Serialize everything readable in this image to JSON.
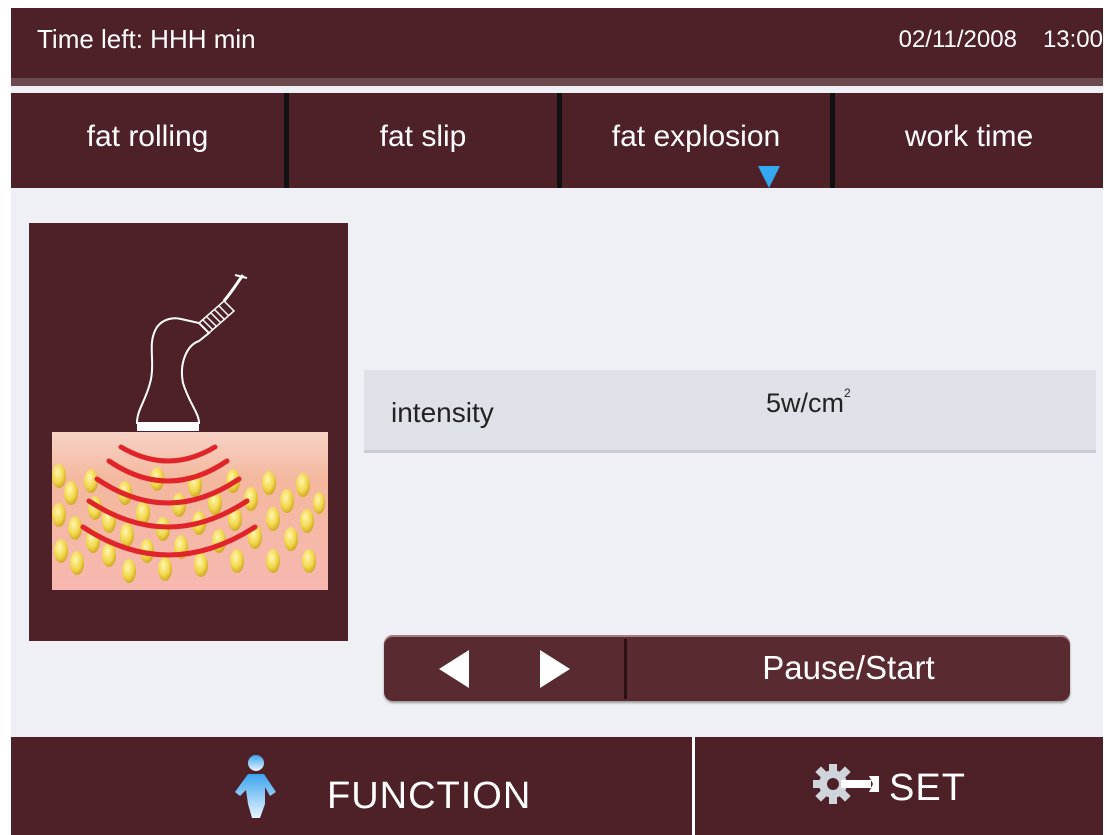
{
  "status": {
    "time_left": "Time left:  HHH min",
    "date": "02/11/2008",
    "time": "13:00"
  },
  "tabs": [
    {
      "label": "fat rolling"
    },
    {
      "label": "fat slip"
    },
    {
      "label": "fat explosion",
      "selected": true
    },
    {
      "label": "work time"
    }
  ],
  "illustration": {
    "icon": "ultrasound-probe-fat-cells-icon"
  },
  "intensity": {
    "label": "intensity",
    "value": "5w/cm",
    "unit_superscript": "2"
  },
  "controls": {
    "prev_icon": "triangle-left-icon",
    "next_icon": "triangle-right-icon",
    "pause_start_label": "Pause/Start"
  },
  "bottom_nav": {
    "function_label": "FUNCTION",
    "function_icon": "person-icon",
    "set_label": "SET",
    "set_icon": "gear-wrench-icon"
  },
  "colors": {
    "bar": "#4d2127",
    "screen": "#eef0f5",
    "accent_blue": "#35a8f2",
    "wave_red": "#e0242a",
    "fat_yellow": "#e8cc3e"
  }
}
